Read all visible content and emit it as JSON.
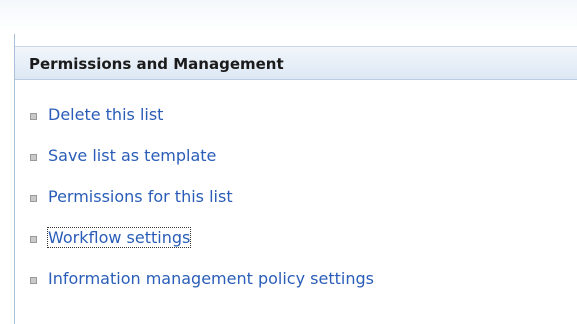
{
  "section": {
    "title": "Permissions and Management"
  },
  "links": [
    {
      "label": "Delete this list"
    },
    {
      "label": "Save list as template"
    },
    {
      "label": "Permissions for this list"
    },
    {
      "label": "Workflow settings"
    },
    {
      "label": "Information management policy settings"
    }
  ]
}
